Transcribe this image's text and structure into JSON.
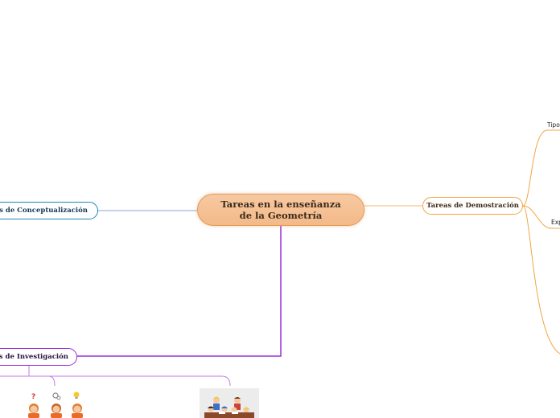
{
  "central": {
    "label": "Tareas en la enseñanza de la Geometría"
  },
  "branches": {
    "demostracion": {
      "label": "Tareas de Demostración",
      "color": "#f0a640"
    },
    "conceptualizacion": {
      "label": "reas de Conceptualización",
      "color": "#1e86b5"
    },
    "investigacion": {
      "label": "reas de Investigación",
      "color": "#9b30d6"
    }
  },
  "leaves": {
    "tipos": {
      "label": "Tipo"
    },
    "exp": {
      "label": "Exp"
    }
  },
  "images": {
    "kids": {
      "icon": "children-thinking-illustration"
    },
    "classroom": {
      "icon": "classroom-illustration"
    }
  }
}
